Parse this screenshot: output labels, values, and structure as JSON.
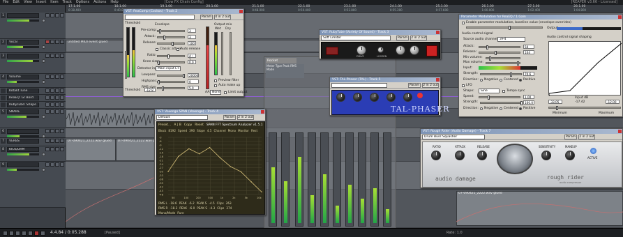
{
  "app": {
    "menu": [
      "File",
      "Edit",
      "View",
      "Insert",
      "Item",
      "Track",
      "Options",
      "Actions",
      "Help"
    ],
    "title": "[Cow FX Chain Config]",
    "right_info": "[REAPER v3.66 - Licensed]"
  },
  "ruler": {
    "bars": [
      "17.1.00",
      "18.1.00",
      "19.1.00",
      "20.1.00",
      "21.1.00",
      "22.1.00",
      "23.1.00",
      "24.1.00",
      "25.1.00",
      "26.1.00",
      "27.1.00",
      "28.1.00"
    ],
    "times": [
      "0:38.400",
      "0:40.800",
      "0:43.200",
      "0:45.600",
      "0:48.000",
      "0:50.400",
      "0:52.800",
      "0:55.200",
      "0:57.600",
      "1:00.000",
      "1:02.400",
      "1:04.800"
    ]
  },
  "tracks": [
    {
      "num": "1",
      "name": "",
      "vol": "",
      "color": "#8fd1ff",
      "vu": 0.7
    },
    {
      "num": "2",
      "name": "Vocal",
      "vol": "-1.0",
      "color": "#8fd1ff",
      "vu": 0.5
    },
    {
      "num": "3",
      "name": "",
      "vol": "",
      "color": "#8fd1ff",
      "vu": 0.8
    },
    {
      "num": "4",
      "name": "Volume",
      "vol": "",
      "color": "#8fd1ff",
      "vu": 0.3
    },
    {
      "num": "",
      "name": "Kotakt Tune",
      "vol": "",
      "color": "#8fd1ff",
      "vu": 0.0
    },
    {
      "num": "",
      "name": "ReaEQ: Gr Bord",
      "vol": "",
      "color": "#8fd1ff",
      "vu": 0.0
    },
    {
      "num": "",
      "name": "RubyTube: Shape",
      "vol": "",
      "color": "#8fd1ff",
      "vu": 0.0
    },
    {
      "num": "5",
      "name": "SNARE",
      "vol": "",
      "color": "#8fd1ff",
      "vu": 0.6
    },
    {
      "num": "6",
      "name": "",
      "vol": "",
      "color": "#8fd1ff",
      "vu": 0.4
    },
    {
      "num": "7",
      "name": "VERBS",
      "vol": "",
      "color": "#8fd1ff",
      "vu": 0.2
    },
    {
      "num": "8",
      "name": "KICK/DRM",
      "vol": "",
      "color": "#8fd1ff",
      "vu": 0.7
    },
    {
      "num": "9",
      "name": "",
      "vol": "",
      "color": "#8fd1ff",
      "vu": 0.3
    }
  ],
  "lanes": {
    "item1": "untitled MIDI event glued",
    "item2": "07-090421_2222.wav glued",
    "item3": "07-090421_2222.wav glued",
    "item4": "07-090421_2222.wav glued",
    "item5": "07-090421_2222.wav glued"
  },
  "transport": {
    "position": "4.4.84 / 0:05.288",
    "status": "[Paused]",
    "rate": "Rate: 1.0"
  },
  "reacomp": {
    "title": "VST: ReaComp (Cockos) - Track 2",
    "preset": "",
    "param_btn": "Param",
    "io_btn": "4 in 2 out",
    "threshold_label": "Threshold",
    "threshold_val": "-12.8",
    "envelope_label": "Envelope",
    "precomp_label": "Pre-comp:",
    "precomp_val": "3",
    "attack_label": "Attack:",
    "attack_val": "3",
    "release_label": "Release:",
    "release_val": "100",
    "classic_label": "Classic attack",
    "autorelease_label": "Auto release",
    "ratio_label": "Ratio:",
    "ratio_val": "4 : 1",
    "knee_label": "Knee size:",
    "knee_val": "0.0",
    "detector_label": "Detector input:",
    "detector_val": "Main input L+R",
    "lowpass_label": "Lowpass:",
    "lowpass_val": "20000",
    "highpass_label": "Highpass:",
    "highpass_val": "0",
    "rms_label": "RMS size:",
    "rms_val": "5.0",
    "output_mix_label": "Output mix",
    "wet_label": "Wet",
    "dry_label": "Dry",
    "preview_filter": "Preview filter",
    "auto_makeup": "Auto make up",
    "limit_output": "Limit output",
    "aa_label": "AA:",
    "aa_val": "None"
  },
  "rubytube": {
    "title": "VST: RubyTube (Variety Of Sound) - Track 3",
    "preset": "Soft Limiter",
    "param_btn": "Param",
    "io_btn": "2 in 2 out",
    "knobs": [
      "DRIVE",
      "LOOSEN",
      "LO",
      "TUBE",
      "HI"
    ]
  },
  "rocket": {
    "title": "Rocket",
    "line1": "Meter Type Peak RMS",
    "line2": "Mode"
  },
  "talphaser": {
    "title": "VST: TAL-Phaser (TAL) - Track 5",
    "param_btn": "Param",
    "io_btn": "2 in 2 out",
    "logo": "TAL-PHASER",
    "knobs": [
      "CUTOFF",
      "RES",
      "RATE",
      "DEPTH",
      "DRY/WET"
    ]
  },
  "param_mod": {
    "title": "Parameter Modulation for ReaEQ / 1 Gain",
    "enable_label": "Enable parameter modulation, baseline value (envelope overrides)",
    "audio_signal_label": "Audio control signal",
    "source_label": "Source audio channel:",
    "source_val": "3+4",
    "attack_label": "Attack:",
    "attack_val": "50",
    "release_label": "Release:",
    "release_val": "104",
    "min_label": "Min volume:",
    "max_label": "Max volume:",
    "input_label": "Input:",
    "strength_label": "Strength:",
    "strength_val": "70.6",
    "direction_label": "Direction:",
    "dir_negative": "Negative",
    "dir_centered": "Centered",
    "dir_positive": "Positive",
    "lfo_label": "LFO",
    "shape_label": "Shape:",
    "shape_val": "Sine",
    "tempo_sync": "Tempo sync",
    "speed_label": "Speed:",
    "speed_val": "1.00",
    "strength2_val": "100.0",
    "phase_label": "Phase:",
    "output_label": "Output",
    "shaping_label": "Audio control signal shaping",
    "input_db_label": "Input dB",
    "input_db_val": "-17.42",
    "left_val": "-33.05",
    "right_val": "-12.00",
    "minimum_label": "Minimum",
    "maximum_label": "Maximum"
  },
  "span": {
    "title": "VST: Voxengo SPAN (Voxengo) - Track 4",
    "preset": "Default",
    "param_btn": "Param",
    "io_btn": "2 in 2 out",
    "toolbar": [
      "Preset...",
      "A | B",
      "Copy",
      "Reset",
      "SPAN FFT Spectrum Analyzer v1.5.1"
    ],
    "row2": [
      "Block",
      "8192",
      "Speed",
      "390",
      "Slope",
      "4.5",
      "Channel",
      "Mono",
      "Monitor",
      "Rest",
      "Sustain",
      "Freq"
    ],
    "y_ticks": [
      "-3",
      "-6",
      "-9",
      "-12",
      "-15",
      "-18",
      "-21",
      "-24",
      "-27",
      "-30",
      "-33",
      "-36",
      "-39",
      "-42",
      "-45",
      "-48"
    ],
    "x_ticks": [
      "50",
      "100",
      "200",
      "500",
      "1k",
      "2k",
      "5k",
      "10k"
    ],
    "stats1": [
      "RMS L",
      "-18.6",
      "PEAK",
      "-6.2",
      "PEAK S",
      "-4.5",
      "Clips",
      "263",
      "Low freq",
      "6.0"
    ],
    "stats2": [
      "RMS R",
      "-18.3",
      "PEAK",
      "-6.0",
      "PEAK S",
      "-4.3",
      "Clips",
      "374",
      "High freq",
      "6.0"
    ],
    "stats3": [
      "Mono/Mode",
      "Pure"
    ]
  },
  "audiodamage": {
    "title": "VST: Rough Rider (Audio Damage) - Track 7",
    "preset": "Drum Buss Squasher",
    "param_btn": "Param",
    "io_btn": "2 in 2 out",
    "knob_labels": [
      "RATIO",
      "ATTACK",
      "RELEASE",
      "SENSITIVITY",
      "MAKEUP"
    ],
    "active_label": "ACTIVE",
    "brand": "audio damage",
    "product": "rough rider",
    "sub": "audio compressor"
  },
  "colors": {
    "envelope": "#8d5fd1",
    "meter_green": "#2fa24a",
    "phaser_blue": "#2b3db5",
    "span_bg": "#2e2b1a",
    "span_curve": "#d9c27a"
  },
  "chart_data": {
    "type": "line",
    "title": "SPAN FFT Spectrum Analyzer v1.5.1",
    "xlabel": "",
    "ylabel": "",
    "x": [
      "20",
      "50",
      "100",
      "200",
      "500",
      "1k",
      "2k",
      "5k",
      "10k",
      "20k"
    ],
    "series": [
      {
        "name": "",
        "values": [
          -30,
          -18,
          -12,
          -16,
          -11,
          -19,
          -26,
          -30,
          -38,
          -46
        ]
      }
    ],
    "ylim": [
      -48,
      -3
    ]
  }
}
